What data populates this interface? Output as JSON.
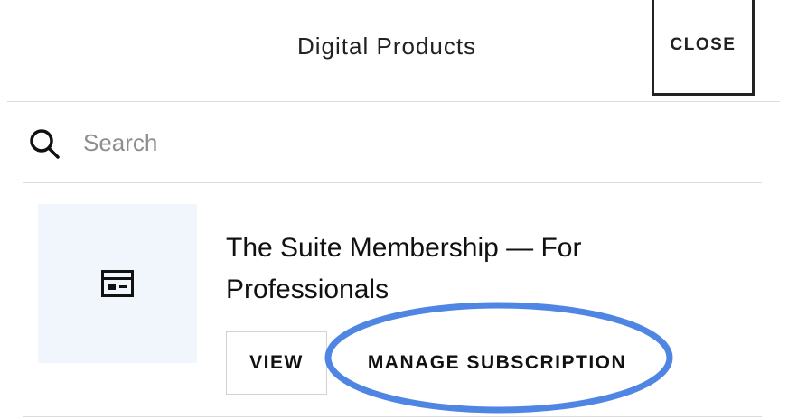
{
  "header": {
    "title": "Digital Products",
    "close_label": "CLOSE"
  },
  "search": {
    "placeholder": "Search",
    "value": ""
  },
  "products": [
    {
      "title": "The Suite Membership — For Professionals",
      "thumbnail_icon": "layout-card-icon",
      "view_label": "VIEW",
      "manage_label": "MANAGE SUBSCRIPTION"
    }
  ],
  "colors": {
    "thumbnail_bg": "#f1f6fd",
    "highlight_ring": "#4f86e4",
    "text": "#111111",
    "placeholder": "#8e8e8e"
  }
}
